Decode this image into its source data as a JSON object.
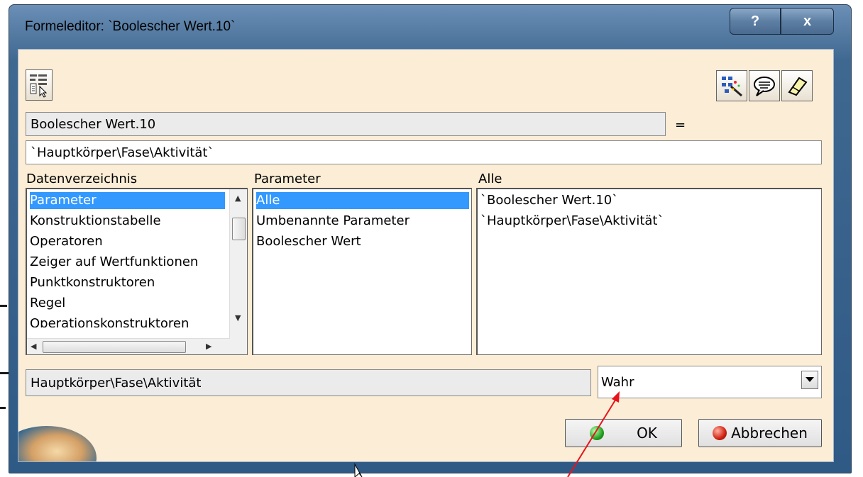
{
  "window": {
    "title": "Formeleditor: `Boolescher Wert.10`",
    "help_label": "?",
    "close_label": "x"
  },
  "icons": {
    "left_toolbar": "hierarchy-select-icon",
    "right_toolbar": [
      "tree-wand-icon",
      "comment-bubble-icon",
      "eraser-icon"
    ]
  },
  "formula": {
    "parameter_name": "Boolescher Wert.10",
    "equals": "=",
    "expression": "`Hauptkörper\\Fase\\Aktivität`"
  },
  "columns": {
    "datenverzeichnis": {
      "header": "Datenverzeichnis",
      "items": [
        "Parameter",
        "Konstruktionstabelle",
        "Operatoren",
        "Zeiger auf Wertfunktionen",
        "Punktkonstruktoren",
        "Regel",
        "Operationskonstruktoren"
      ],
      "selected": 0
    },
    "parameter": {
      "header": "Parameter",
      "items": [
        "Alle",
        "Umbenannte Parameter",
        "Boolescher Wert"
      ],
      "selected": 0
    },
    "alle": {
      "header": "Alle",
      "items": [
        "`Boolescher Wert.10`",
        "`Hauptkörper\\Fase\\Aktivität`"
      ]
    }
  },
  "bottom": {
    "selected_path": "Hauptkörper\\Fase\\Aktivität",
    "value": "Wahr"
  },
  "buttons": {
    "ok": "OK",
    "cancel": "Abbrechen"
  },
  "colors": {
    "selection": "#3399ff",
    "client_bg": "#fbedd6",
    "annotation_arrow": "#e8141c"
  }
}
